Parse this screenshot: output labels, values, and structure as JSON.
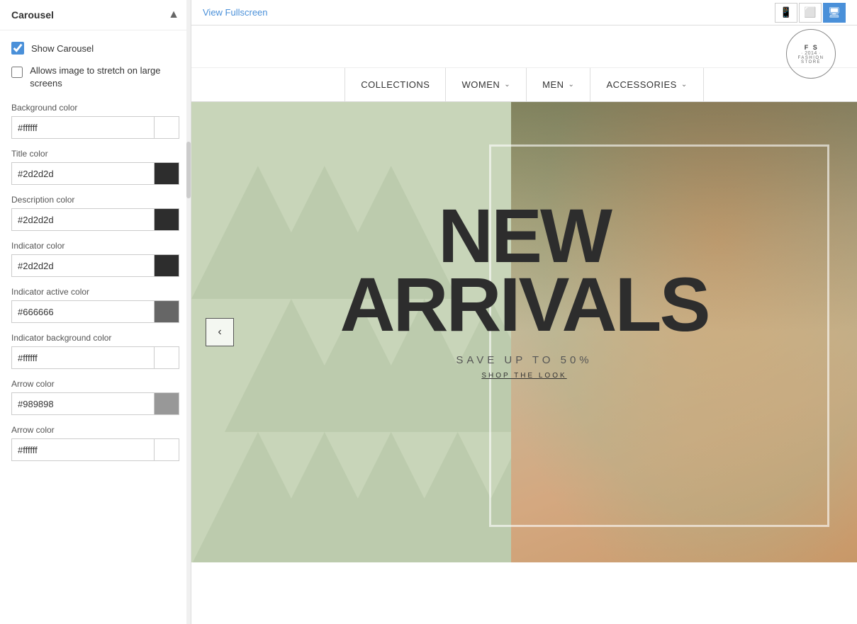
{
  "panel": {
    "title": "Carousel",
    "show_carousel_label": "Show Carousel",
    "show_carousel_checked": true,
    "stretch_label": "Allows image to stretch on large screens",
    "stretch_checked": false,
    "fields": [
      {
        "id": "bg_color",
        "label": "Background color",
        "value": "#ffffff",
        "swatch": "#ffffff"
      },
      {
        "id": "title_color",
        "label": "Title color",
        "value": "#2d2d2d",
        "swatch": "#2d2d2d"
      },
      {
        "id": "desc_color",
        "label": "Description color",
        "value": "#2d2d2d",
        "swatch": "#2d2d2d"
      },
      {
        "id": "indicator_color",
        "label": "Indicator color",
        "value": "#2d2d2d",
        "swatch": "#2d2d2d"
      },
      {
        "id": "indicator_active_color",
        "label": "Indicator active color",
        "value": "#666666",
        "swatch": "#666666"
      },
      {
        "id": "indicator_bg_color",
        "label": "Indicator background color",
        "value": "#ffffff",
        "swatch": "#ffffff"
      },
      {
        "id": "arrow_color1",
        "label": "Arrow color",
        "value": "#989898",
        "swatch": "#989898"
      },
      {
        "id": "arrow_color2",
        "label": "Arrow color",
        "value": "#ffffff",
        "swatch": "#ffffff"
      }
    ]
  },
  "toolbar": {
    "view_fullscreen": "View Fullscreen"
  },
  "store_logo": {
    "f": "F",
    "s": "S",
    "year": "2014",
    "name": "FASHION STORE"
  },
  "nav": {
    "items": [
      {
        "label": "COLLECTIONS",
        "has_dropdown": false
      },
      {
        "label": "WOMEN",
        "has_dropdown": true
      },
      {
        "label": "MEN",
        "has_dropdown": true
      },
      {
        "label": "ACCESSORIES",
        "has_dropdown": true
      }
    ]
  },
  "hero": {
    "title_line1": "NEW",
    "title_line2": "ARRIVALS",
    "subtitle": "SAVE UP TO 50%",
    "cta": "SHOP THE LOOK"
  },
  "devices": {
    "mobile_label": "📱",
    "tablet_label": "⬜",
    "desktop_label": "🖥"
  }
}
